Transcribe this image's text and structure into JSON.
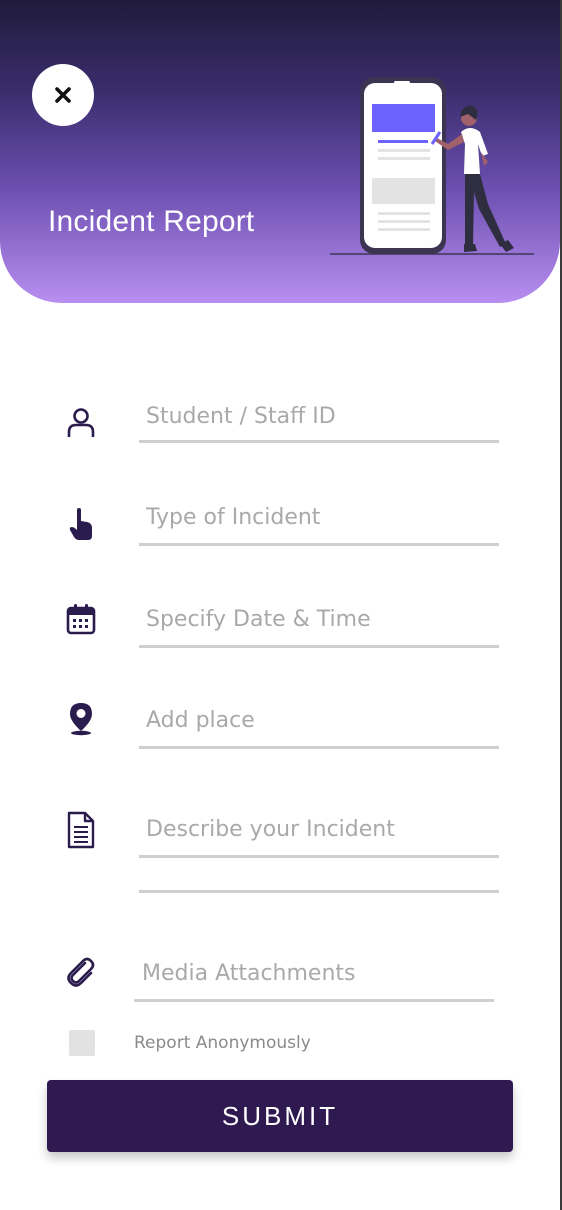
{
  "header": {
    "title": "Incident Report",
    "close_icon": "close-icon",
    "gradient_colors": [
      "#1f1b3c",
      "#6b4fb0",
      "#b98ef1"
    ]
  },
  "form": {
    "fields": [
      {
        "id": "id",
        "icon": "person-icon",
        "placeholder": "Student / Staff ID"
      },
      {
        "id": "type",
        "icon": "hand-pointer-icon",
        "placeholder": "Type of Incident"
      },
      {
        "id": "datetime",
        "icon": "calendar-icon",
        "placeholder": "Specify Date & Time"
      },
      {
        "id": "place",
        "icon": "location-pin-icon",
        "placeholder": "Add place"
      },
      {
        "id": "description",
        "icon": "document-icon",
        "placeholder": "Describe your Incident"
      },
      {
        "id": "media",
        "icon": "paperclip-icon",
        "placeholder": "Media Attachments"
      }
    ],
    "anonymous_label": "Report Anonymously",
    "submit_label": "SUBMIT"
  },
  "colors": {
    "accent": "#2e1a51",
    "icon": "#2b1c4e",
    "underline": "#cfcfcf",
    "placeholder": "#a9a9a9"
  }
}
